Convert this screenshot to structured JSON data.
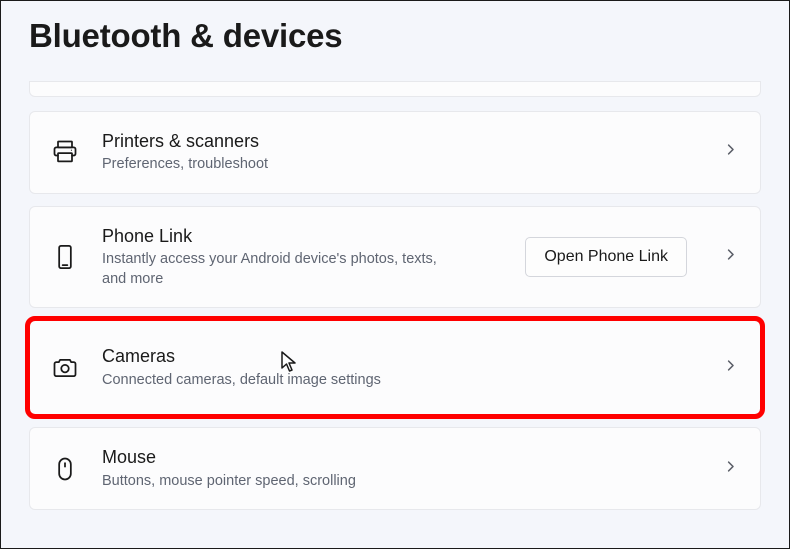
{
  "page": {
    "title": "Bluetooth & devices"
  },
  "cards": {
    "printers": {
      "title": "Printers & scanners",
      "sub": "Preferences, troubleshoot"
    },
    "phone": {
      "title": "Phone Link",
      "sub": "Instantly access your Android device's photos, texts, and more",
      "action": "Open Phone Link"
    },
    "cameras": {
      "title": "Cameras",
      "sub": "Connected cameras, default image settings"
    },
    "mouse": {
      "title": "Mouse",
      "sub": "Buttons, mouse pointer speed, scrolling"
    }
  }
}
